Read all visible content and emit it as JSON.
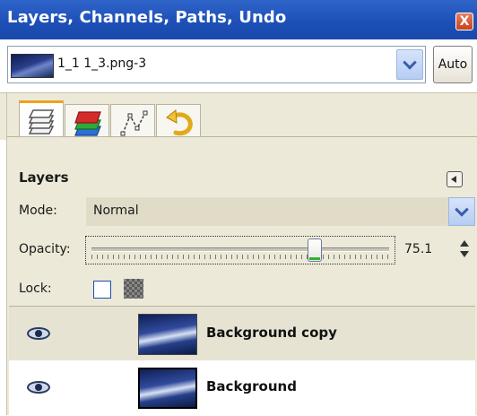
{
  "window": {
    "title": "Layers, Channels, Paths, Undo",
    "close_label": "X"
  },
  "image_selector": {
    "name": "1_1 1_3.png-3",
    "auto_label": "Auto"
  },
  "tabs": [
    {
      "name": "layers",
      "icon": "layers-icon",
      "active": true
    },
    {
      "name": "channels",
      "icon": "channels-icon",
      "active": false
    },
    {
      "name": "paths",
      "icon": "paths-icon",
      "active": false
    },
    {
      "name": "undo",
      "icon": "undo-icon",
      "active": false
    }
  ],
  "panel": {
    "title": "Layers",
    "mode_label": "Mode:",
    "mode_value": "Normal",
    "opacity_label": "Opacity:",
    "opacity_value": "75.1",
    "opacity_fraction": 0.751,
    "lock_label": "Lock:"
  },
  "layers": [
    {
      "name": "Background copy",
      "visible": true,
      "selected": true
    },
    {
      "name": "Background",
      "visible": true,
      "selected": false
    }
  ]
}
